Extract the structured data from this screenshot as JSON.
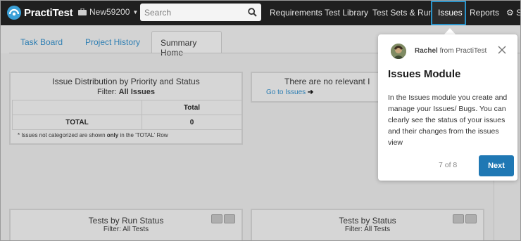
{
  "navbar": {
    "logo_text": "PractiTest",
    "project_name": "New59200",
    "search_placeholder": "Search",
    "links": {
      "requirements": "Requirements",
      "test_library": "Test Library",
      "test_sets_runs": "Test Sets & Runs",
      "issues": "Issues",
      "reports": "Reports"
    }
  },
  "tabs": {
    "task_board": "Task Board",
    "project_history": "Project History",
    "summary_home": "Summary Home"
  },
  "issue_panel": {
    "title": "Issue Distribution by Priority and Status",
    "filter_label": "Filter:",
    "filter_value": "All Issues",
    "column_total": "Total",
    "row_label": "TOTAL",
    "row_value": "0",
    "note_before": "* Issues not categorized are shown",
    "note_bold": "only",
    "note_after": "in the 'TOTAL' Row"
  },
  "relevant_panel": {
    "title": "There are no relevant I",
    "link": "Go to Issues"
  },
  "run_status_panel": {
    "title": "Tests by Run Status",
    "filter": "Filter: All Tests"
  },
  "status_panel": {
    "title": "Tests by Status",
    "filter": "Filter: All Tests"
  },
  "popover": {
    "sender_name": "Rachel",
    "sender_suffix": "from PractiTest",
    "title": "Issues Module",
    "body": "In the Issues module you create and manage your Issues/ Bugs. You can clearly see the status of your issues and their changes from the issues view",
    "step": "7 of 8",
    "next_label": "Next"
  },
  "colors": {
    "navbar": "#1f1f1f",
    "accent": "#2a93c9",
    "next_button": "#1f78b4",
    "link": "#2f7fb3"
  }
}
